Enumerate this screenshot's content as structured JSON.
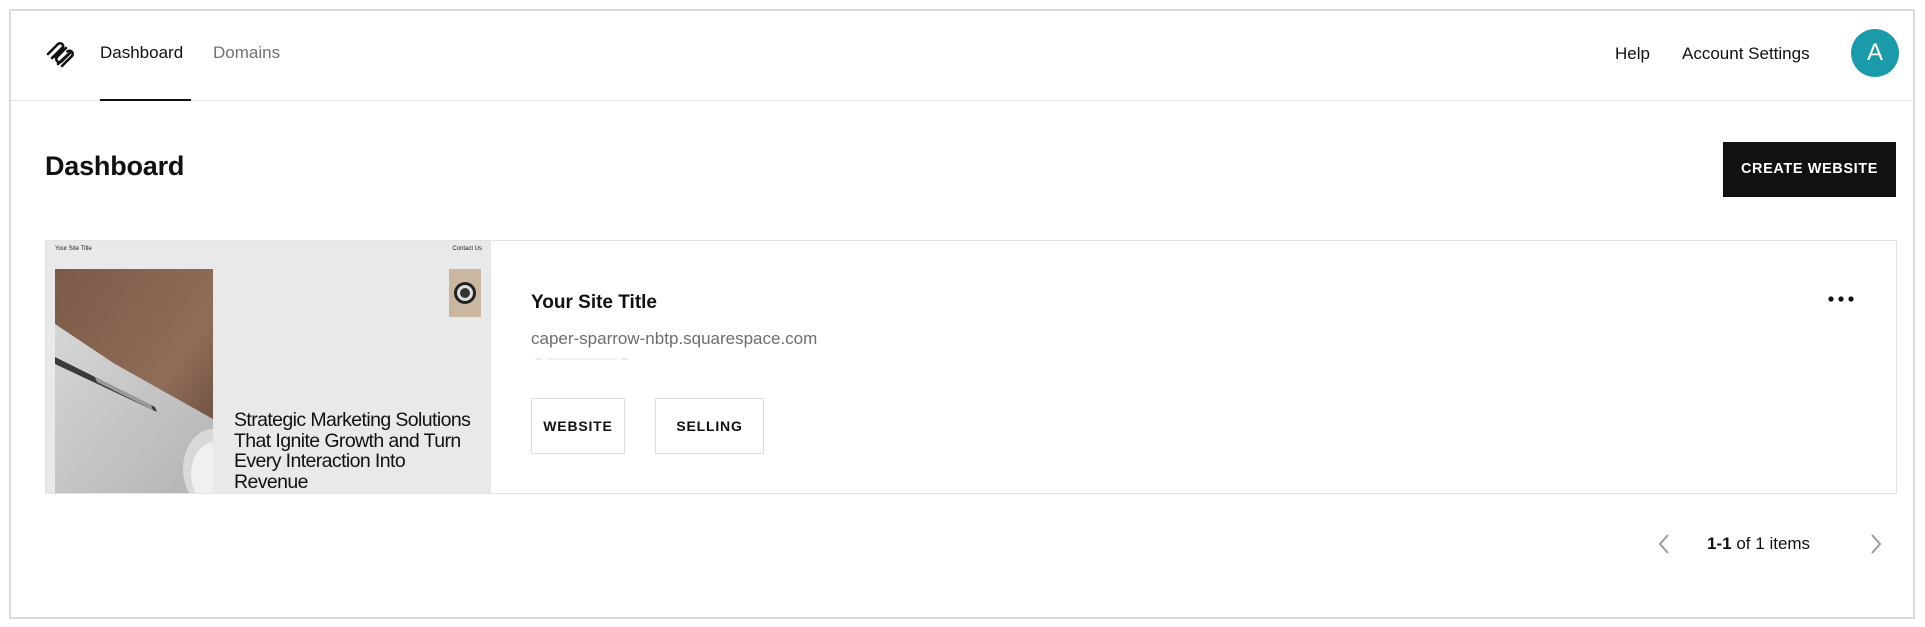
{
  "nav": {
    "tabs": [
      {
        "label": "Dashboard",
        "active": true
      },
      {
        "label": "Domains",
        "active": false
      }
    ],
    "help_label": "Help",
    "account_settings_label": "Account Settings",
    "avatar_initial": "A",
    "avatar_color": "#1b9aaa"
  },
  "header": {
    "title": "Dashboard",
    "create_button_label": "CREATE WEBSITE"
  },
  "site_card": {
    "title": "Your Site Title",
    "url": "caper-sparrow-nbtp.squarespace.com",
    "thumbnail": {
      "site_title": "Your Site Title",
      "contact_link": "Contact Us",
      "headline": "Strategic Marketing Solutions That Ignite Growth and Turn Every Interaction Into Revenue"
    },
    "buttons": [
      {
        "label": "WEBSITE"
      },
      {
        "label": "SELLING"
      }
    ],
    "more_icon": "ellipsis-icon"
  },
  "pagination": {
    "range": "1-1",
    "of_text": "of",
    "total": "1",
    "items_text": "items",
    "prev_icon": "chevron-left-icon",
    "next_icon": "chevron-right-icon"
  }
}
